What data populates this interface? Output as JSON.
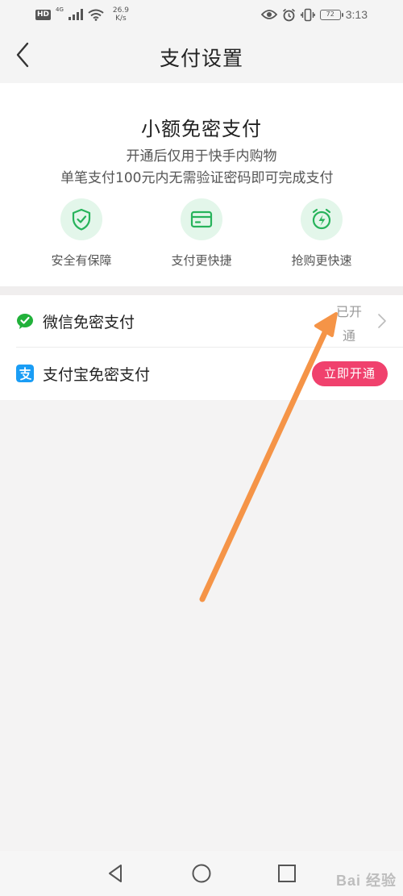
{
  "status_bar": {
    "hd_badge": "HD",
    "network_type": "4G",
    "speed_value": "26.9",
    "speed_unit": "K/s",
    "battery": "72",
    "time": "3:13",
    "icons": [
      "signal-icon",
      "wifi-icon",
      "eye-icon",
      "alarm-icon",
      "vibrate-icon",
      "battery-icon"
    ]
  },
  "header": {
    "title": "支付设置",
    "back_icon": "chevron-left-icon"
  },
  "intro": {
    "title": "小额免密支付",
    "desc_line1": "开通后仅用于快手内购物",
    "desc_line2": "单笔支付100元内无需验证密码即可完成支付",
    "features": [
      {
        "label": "安全有保障",
        "icon": "shield-check-icon"
      },
      {
        "label": "支付更快捷",
        "icon": "card-icon"
      },
      {
        "label": "抢购更快速",
        "icon": "clock-lightning-icon"
      }
    ],
    "accent_color": "#27b35b",
    "icon_bg_color": "#e3f6ea"
  },
  "payment_methods": [
    {
      "label": "微信免密支付",
      "icon": "wechat-pay-icon",
      "status": "已开通",
      "icon_color": "#21b13a"
    },
    {
      "label": "支付宝免密支付",
      "icon": "alipay-icon",
      "action": "立即开通",
      "icon_color": "#1a9df5",
      "button_color": "#f0416d"
    }
  ],
  "annotation": {
    "arrow_color": "#f59447"
  },
  "nav_bar": {
    "icons": [
      "nav-back-icon",
      "nav-home-icon",
      "nav-recents-icon"
    ]
  },
  "watermark": {
    "text": "Bai 经验"
  }
}
